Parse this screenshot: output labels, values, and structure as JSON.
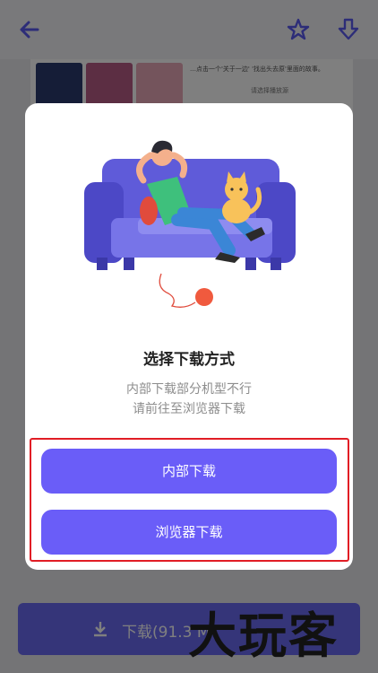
{
  "background_page": {
    "strip_line1": "…点击一个'关于一边' '找出头去原'里面的故事。",
    "strip_line2": "请选择播放源",
    "download_bar_label": "下载(91.3 M"
  },
  "dialog": {
    "title": "选择下载方式",
    "subtitle_line1": "内部下载部分机型不行",
    "subtitle_line2": "请前往至浏览器下载",
    "internal_download_label": "内部下载",
    "browser_download_label": "浏览器下载"
  },
  "watermark": "大玩客",
  "colors": {
    "accent": "#6a5df8",
    "highlight": "#e11d25",
    "sofa": "#5f5bd9"
  }
}
